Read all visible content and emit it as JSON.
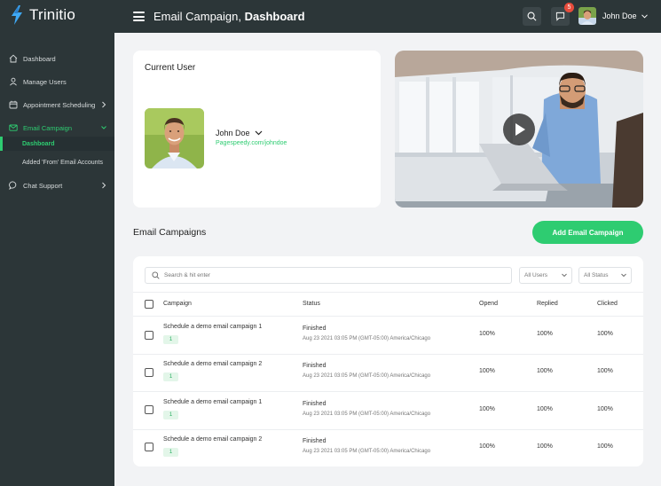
{
  "brand": {
    "name": "Trinitio",
    "logo_icon": "bolt-logo-icon",
    "accent": "#2ecc71"
  },
  "header": {
    "title_light": "Email Campaign, ",
    "title_bold": "Dashboard",
    "notification_count": "5",
    "user_name": "John Doe"
  },
  "sidebar": {
    "items": [
      {
        "label": "Dashboard",
        "icon": "home-icon"
      },
      {
        "label": "Manage Users",
        "icon": "user-icon"
      },
      {
        "label": "Appointment Scheduling",
        "icon": "calendar-icon"
      },
      {
        "label": "Email Campaign",
        "icon": "mail-icon"
      },
      {
        "label": "Chat Support",
        "icon": "chat-icon"
      }
    ],
    "sub_items": [
      {
        "label": "Dashboard"
      },
      {
        "label": "Added 'From' Email Accounts"
      }
    ]
  },
  "current_user": {
    "title": "Current User",
    "name": "John Doe",
    "link": "Pagespeedy.com/johndoe"
  },
  "campaigns": {
    "title": "Email Campaigns",
    "add_button": "Add Email Campaign",
    "search_placeholder": "Search & hit enter",
    "filter_users": "All Users",
    "filter_status": "All Status",
    "columns": [
      "Campaign",
      "Status",
      "Opend",
      "Replied",
      "Clicked"
    ],
    "rows": [
      {
        "name": "Schedule a demo email campaign 1",
        "count": "1",
        "status": "Finished",
        "date": "Aug 23 2021 03:05 PM (GMT-05:00) America/Chicago",
        "opened": "100%",
        "replied": "100%",
        "clicked": "100%"
      },
      {
        "name": "Schedule a demo email campaign 2",
        "count": "1",
        "status": "Finished",
        "date": "Aug 23 2021 03:05 PM (GMT-05:00) America/Chicago",
        "opened": "100%",
        "replied": "100%",
        "clicked": "100%"
      },
      {
        "name": "Schedule a demo email campaign 1",
        "count": "1",
        "status": "Finished",
        "date": "Aug 23 2021 03:05 PM (GMT-05:00) America/Chicago",
        "opened": "100%",
        "replied": "100%",
        "clicked": "100%"
      },
      {
        "name": "Schedule a demo email campaign 2",
        "count": "1",
        "status": "Finished",
        "date": "Aug 23 2021 03:05 PM (GMT-05:00) America/Chicago",
        "opened": "100%",
        "replied": "100%",
        "clicked": "100%"
      }
    ]
  }
}
